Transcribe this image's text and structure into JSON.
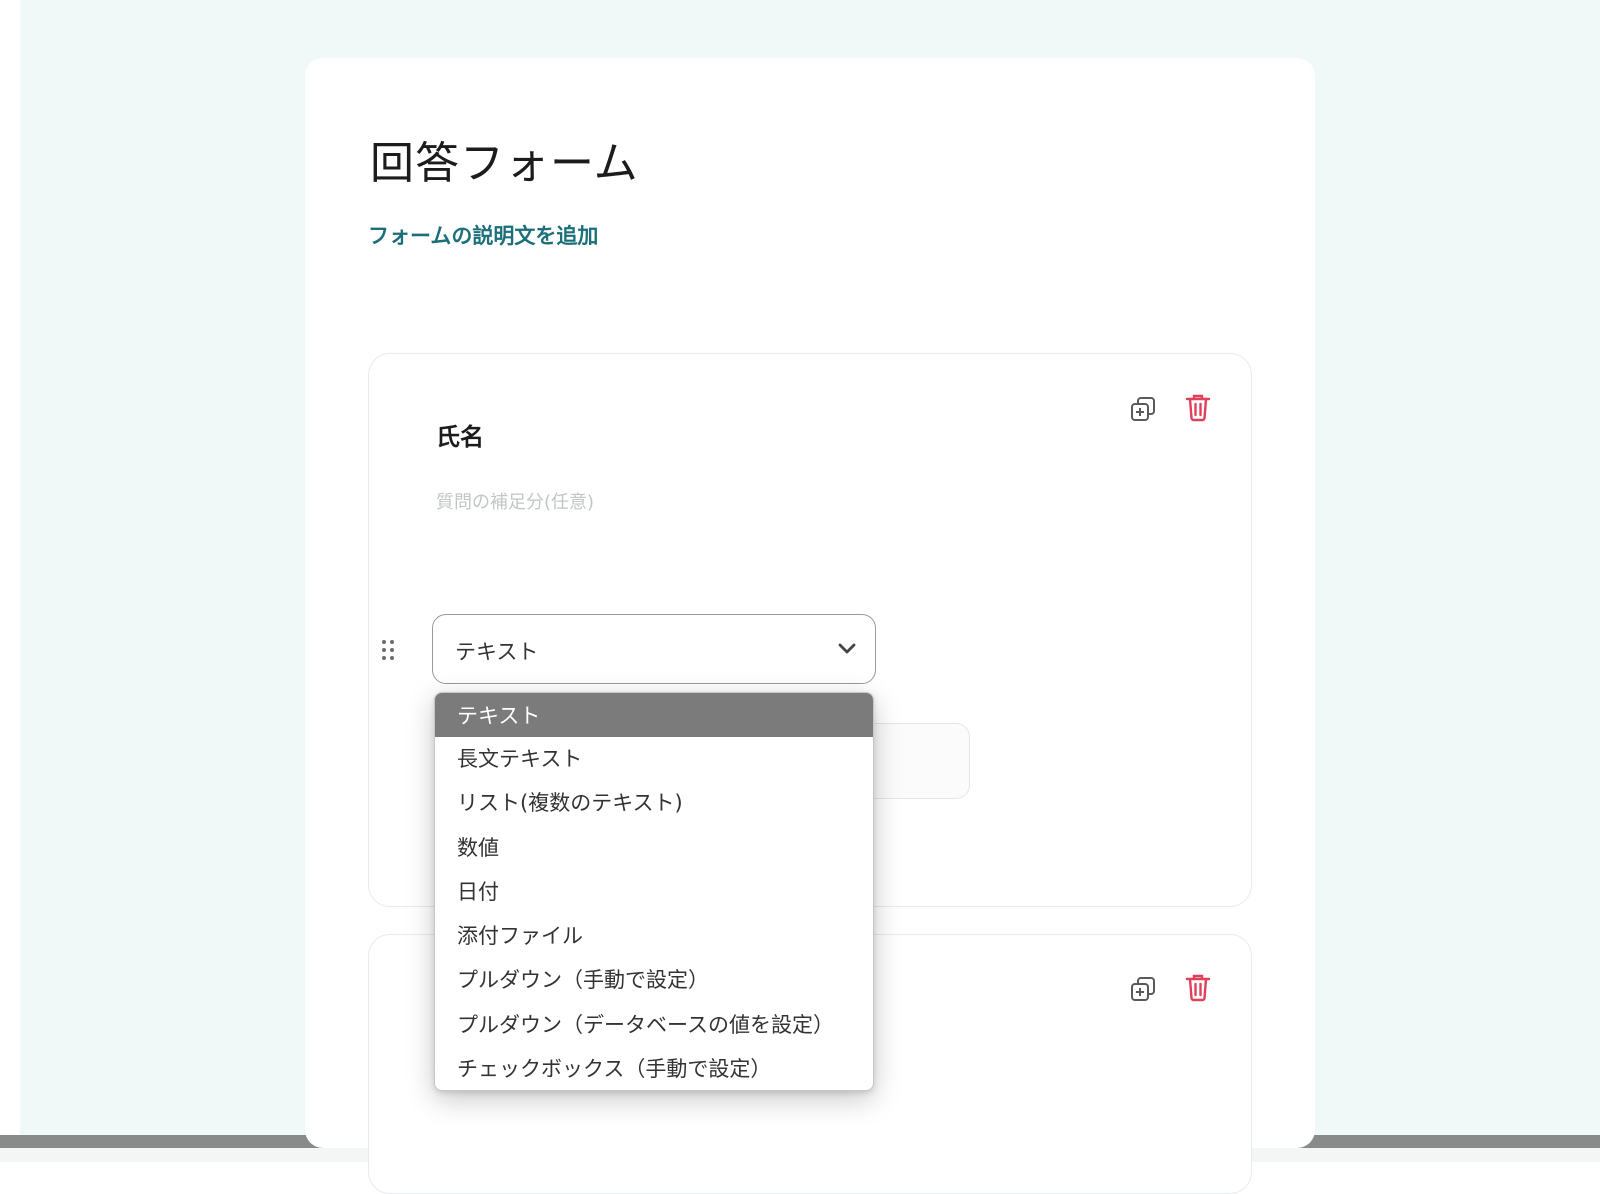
{
  "form": {
    "title": "回答フォーム",
    "add_description_link": "フォームの説明文を追加"
  },
  "question": {
    "title": "氏名",
    "hint_placeholder": "質問の補足分(任意)",
    "type_select": {
      "selected": "テキスト",
      "options": [
        "テキスト",
        "長文テキスト",
        "リスト(複数のテキスト)",
        "数値",
        "日付",
        "添付ファイル",
        "プルダウン（手動で設定）",
        "プルダウン（データベースの値を設定）",
        "チェックボックス（手動で設定）"
      ]
    }
  },
  "icons": {
    "duplicate": "duplicate-icon",
    "delete": "trash-icon",
    "drag": "drag-handle-icon",
    "chevron": "chevron-down-icon"
  },
  "colors": {
    "background": "#f1f9f8",
    "link": "#1b6f7a",
    "delete": "#e0405a",
    "selected_option": "#7b7b7b"
  }
}
